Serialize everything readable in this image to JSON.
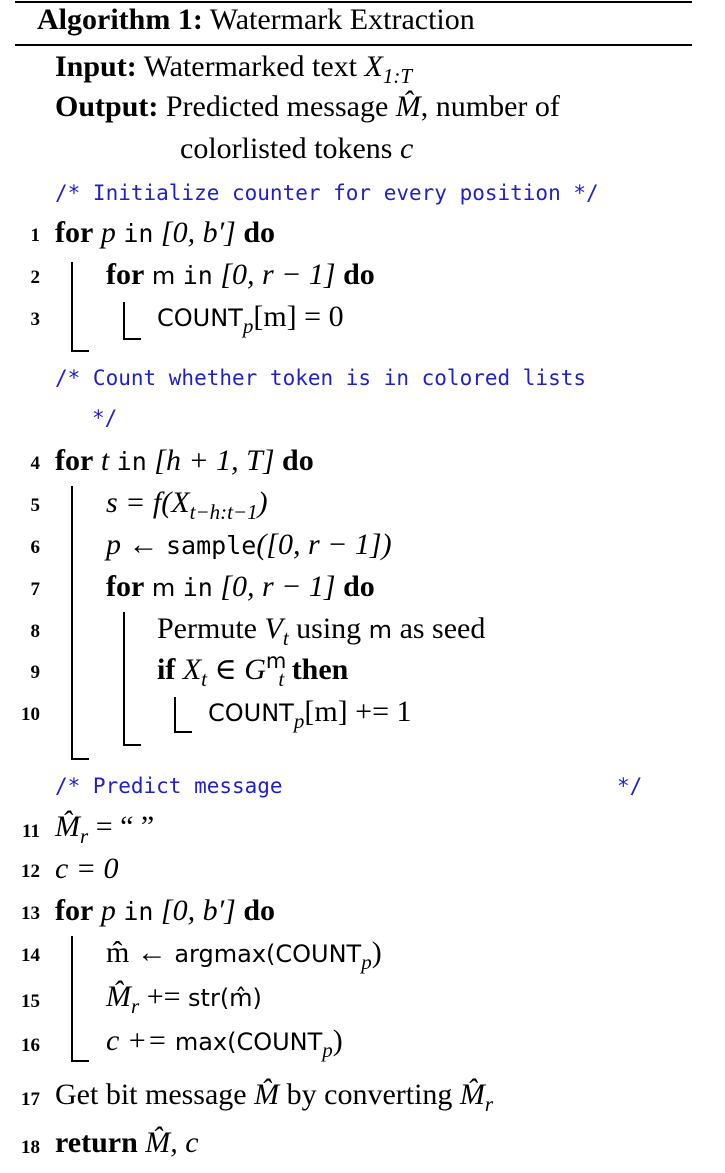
{
  "algorithm": {
    "label": "Algorithm 1:",
    "title": "Watermark Extraction"
  },
  "header": {
    "input_kw": "Input:",
    "input_text": "Watermarked text",
    "input_var": "X",
    "input_sub": "1:T",
    "output_kw": "Output:",
    "output_text1": "Predicted message",
    "output_var": "M̂",
    "output_text2": ", number of",
    "output_text3": "colorlisted tokens",
    "output_var2": "c"
  },
  "comments": {
    "c1": "/* Initialize counter for every position */",
    "c2a": "/* Count whether token is in colored lists",
    "c2b": "*/",
    "c3a": "/* Predict message",
    "c3b": "*/"
  },
  "lines": [
    {
      "n": "1"
    },
    {
      "n": "2"
    },
    {
      "n": "3"
    },
    {
      "n": "4"
    },
    {
      "n": "5"
    },
    {
      "n": "6"
    },
    {
      "n": "7"
    },
    {
      "n": "8"
    },
    {
      "n": "9"
    },
    {
      "n": "10"
    },
    {
      "n": "11"
    },
    {
      "n": "12"
    },
    {
      "n": "13"
    },
    {
      "n": "14"
    },
    {
      "n": "15"
    },
    {
      "n": "16"
    },
    {
      "n": "17"
    },
    {
      "n": "18"
    }
  ],
  "keywords": {
    "for": "for",
    "do": "do",
    "in": "in",
    "if": "if",
    "then": "then",
    "return": "return"
  },
  "code": {
    "l1_var": "p",
    "l1_range": "[0, b′]",
    "l2_var": "m",
    "l2_range": "[0, r − 1]",
    "l3_count": "COUNT",
    "l3_sub": "p",
    "l3_rest": "[m] = 0",
    "l4_var": "t",
    "l4_range": "[h + 1, T]",
    "l5": "s = f(X",
    "l5_sub": "t−h:t−1",
    "l5_end": ")",
    "l6_var": "p ←",
    "l6_fn": "sample",
    "l6_arg": "([0, r − 1])",
    "l7_var": "m",
    "l7_range": "[0, r − 1]",
    "l8_a": "Permute",
    "l8_v": "V",
    "l8_vsub": "t",
    "l8_b": "using",
    "l8_m": "m",
    "l8_c": "as seed",
    "l9_x": "X",
    "l9_xsub": "t",
    "l9_in": "∈ G",
    "l9_sup": "m",
    "l9_sub": "t",
    "l10_count": "COUNT",
    "l10_sub": "p",
    "l10_rest": "[m] += 1",
    "l11": "M̂",
    "l11_sub": "r",
    "l11_rest": "= “ ”",
    "l12": "c = 0",
    "l13_var": "p",
    "l13_range": "[0, b′]",
    "l14_a": "m̂ ←",
    "l14_fn": "argmax(COUNT",
    "l14_sub": "p",
    "l14_end": ")",
    "l15_a": "M̂",
    "l15_sub": "r",
    "l15_b": "+=",
    "l15_fn": "str(m̂)",
    "l16_a": "c +=",
    "l16_fn": "max(COUNT",
    "l16_sub": "p",
    "l16_end": ")",
    "l17_a": "Get bit message",
    "l17_m": "M̂",
    "l17_b": "by converting",
    "l17_mr": "M̂",
    "l17_sub": "r",
    "l18_m": "M̂",
    "l18_c": ", c"
  }
}
